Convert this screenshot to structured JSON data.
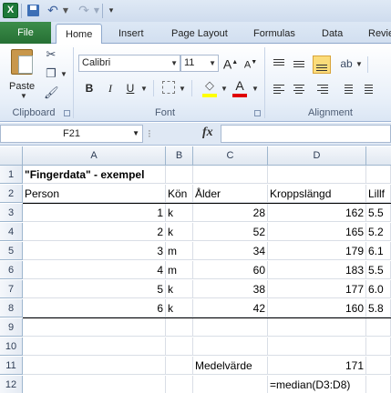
{
  "app": {
    "excel_icon": "X",
    "qat_icons": [
      "save-icon",
      "undo-icon",
      "redo-icon",
      "customize-icon"
    ]
  },
  "tabs": [
    {
      "label": "File"
    },
    {
      "label": "Home",
      "active": true
    },
    {
      "label": "Insert"
    },
    {
      "label": "Page Layout"
    },
    {
      "label": "Formulas"
    },
    {
      "label": "Data"
    },
    {
      "label": "Revie"
    }
  ],
  "ribbon": {
    "clipboard": {
      "label": "Clipboard",
      "paste_label": "Paste"
    },
    "font": {
      "label": "Font",
      "font_name": "Calibri",
      "font_size": "11",
      "grow": "A",
      "shrink": "A",
      "bold": "B",
      "italic": "I",
      "underline": "U",
      "font_color_letter": "A"
    },
    "alignment": {
      "label": "Alignment"
    }
  },
  "formula_bar": {
    "name_box": "F21",
    "fx_label": "fx",
    "formula": ""
  },
  "sheet": {
    "columns": [
      "A",
      "B",
      "C",
      "D"
    ],
    "rows": [
      "1",
      "2",
      "3",
      "4",
      "5",
      "6",
      "7",
      "8",
      "9",
      "10",
      "11",
      "12"
    ],
    "title": "\"Fingerdata\" - exempel",
    "headers": {
      "person": "Person",
      "kon": "Kön",
      "alder": "Ålder",
      "langd": "Kroppslängd",
      "lillf": "Lillf"
    },
    "data": [
      {
        "person": "1",
        "kon": "k",
        "alder": "28",
        "langd": "162",
        "lillf": "5.5"
      },
      {
        "person": "2",
        "kon": "k",
        "alder": "52",
        "langd": "165",
        "lillf": "5.2"
      },
      {
        "person": "3",
        "kon": "m",
        "alder": "34",
        "langd": "179",
        "lillf": "6.1"
      },
      {
        "person": "4",
        "kon": "m",
        "alder": "60",
        "langd": "183",
        "lillf": "5.5"
      },
      {
        "person": "5",
        "kon": "k",
        "alder": "38",
        "langd": "177",
        "lillf": "6.0"
      },
      {
        "person": "6",
        "kon": "k",
        "alder": "42",
        "langd": "160",
        "lillf": "5.8"
      }
    ],
    "medel_label": "Medelvärde",
    "medel_value": "171",
    "formula_text": "=median(D3:D8)"
  },
  "colors": {
    "file_tab": "#2e7d3c",
    "grid_line": "#d9dee6",
    "header_bg": "#e1e8f1"
  }
}
